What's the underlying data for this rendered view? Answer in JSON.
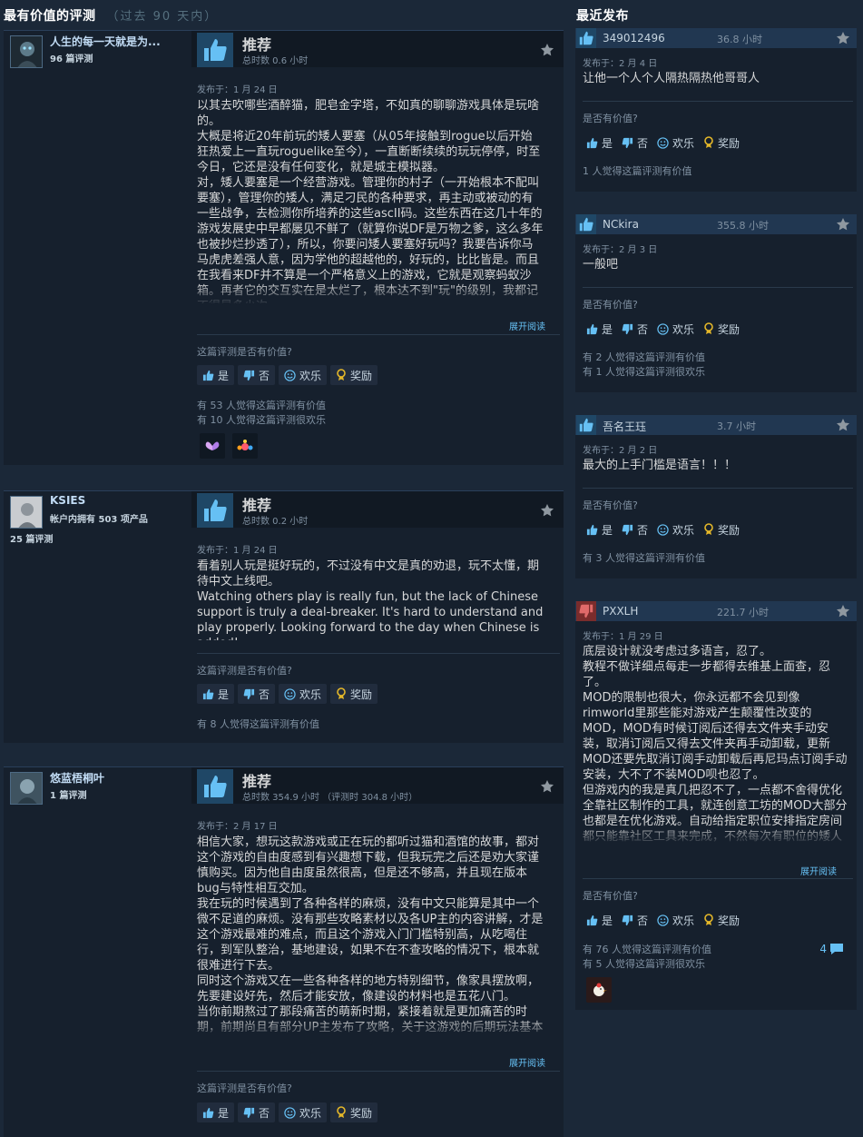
{
  "left_section": {
    "title": "最有价值的评测",
    "subtitle": "（过去 90 天内）"
  },
  "right_section": {
    "title": "最近发布"
  },
  "labels": {
    "recommended": "推荐",
    "helpful_question": "这篇评测是否有价值?",
    "yes": "是",
    "no": "否",
    "funny": "欢乐",
    "award": "奖励",
    "read_more": "展开阅读",
    "helpful_question_short": "是否有价值?"
  },
  "colors": {
    "background": "#1b2838",
    "card": "#16202d",
    "accent_link": "#66c0f4",
    "thumb_up_bg": "#1f4766",
    "thumb_down_bg": "#7a2c2c"
  },
  "reviews": [
    {
      "author": "人生的每一天就是为...",
      "author_line2": "96 篇评测",
      "author_line3": "",
      "recommendation": "推荐",
      "hours": "总时数 0.6 小时",
      "posted": "发布于：1 月 24 日",
      "text": "以其去吹哪些酒醉猫，肥皂金字塔，不如真的聊聊游戏具体是玩啥的。\n大概是将近20年前玩的矮人要塞（从05年接触到rogue以后开始狂热爱上一直玩roguelike至今），一直断断续续的玩玩停停，时至今日，它还是没有任何变化，就是城主模拟器。\n对，矮人要塞是一个经营游戏。管理你的村子（一开始根本不配叫要塞），管理你的矮人，满足刁民的各种要求，再主动或被动的有一些战争，去检测你所培养的这些ascII码。这些东西在这几十年的游戏发展史中早都屡见不鲜了（就算你说DF是万物之爹，这么多年也被抄烂抄透了），所以，你要问矮人要塞好玩吗？我要告诉你马马虎虎差强人意，因为学他的超越他的，好玩的，比比皆是。而且在我看来DF并不算是一个严格意义上的游戏，它就是观察蚂蚁沙箱。再者它的交互实在是太烂了，根本达不到\"玩\"的级别，我都记不得是多少次",
      "read_more": "展开阅读",
      "votes": "有 53 人觉得这篇评测有价值\n有 10 人觉得这篇评测很欢乐"
    },
    {
      "author": "KSIES",
      "author_line2": "帐户内拥有 503 项产品",
      "author_line3": "25 篇评测",
      "recommendation": "推荐",
      "hours": "总时数 0.2 小时",
      "posted": "发布于：1 月 24 日",
      "text": "看着别人玩是挺好玩的，不过没有中文是真的劝退，玩不太懂，期待中文上线吧。\nWatching others play is really fun, but the lack of Chinese support is truly a deal-breaker. It's hard to understand and play properly. Looking forward to the day when Chinese is added!",
      "votes": "有 8 人觉得这篇评测有价值"
    },
    {
      "author": "悠蓝梧桐叶",
      "author_line2": "1 篇评测",
      "author_line3": "",
      "recommendation": "推荐",
      "hours": "总时数 354.9 小时 （评测时 304.8 小时）",
      "posted": "发布于：2 月 17 日",
      "text": "相信大家，想玩这款游戏或正在玩的都听过猫和酒馆的故事，都对这个游戏的自由度感到有兴趣想下载，但我玩完之后还是劝大家谨慎购买。因为他自由度虽然很高，但是还不够高，并且现在版本bug与特性相互交加。\n我在玩的时候遇到了各种各样的麻烦，没有中文只能算是其中一个微不足道的麻烦。没有那些攻略素材以及各UP主的内容讲解，才是这个游戏最难的难点，而且这个游戏入门门槛特别高，从吃喝住行，到军队整治，基地建设，如果不在不查攻略的情况下，根本就很难进行下去。\n同时这个游戏又在一些各种各样的地方特别细节，像家具摆放啊，先要建设好先，然后才能安放，像建设的材料也是五花八门。\n当你前期熬过了那段痛苦的萌新时期，紧接着就是更加痛苦的时期，前期尚且有部分UP主发布了攻略，关于这游戏的后期玩法基本没",
      "read_more": "展开阅读"
    }
  ],
  "recent": [
    {
      "type": "up",
      "author": "349012496",
      "hours": "36.8 小时",
      "posted": "发布于：2 月 4 日",
      "text": "让他一个人个人隔热隔热他哥哥人",
      "votes": "1 人觉得这篇评测有价值"
    },
    {
      "type": "up",
      "author": "NCkira",
      "hours": "355.8 小时",
      "posted": "发布于：2 月 3 日",
      "text": "一般吧",
      "votes": "有 2 人觉得这篇评测有价值\n有 1 人觉得这篇评测很欢乐"
    },
    {
      "type": "up",
      "author": "吾名王珏",
      "hours": "3.7 小时",
      "posted": "发布于：2 月 2 日",
      "text": "最大的上手门槛是语言！！！",
      "votes": "有 3 人觉得这篇评测有价值"
    },
    {
      "type": "down",
      "author": "PXXLH",
      "hours": "221.7 小时",
      "posted": "发布于：1 月 29 日",
      "text": "底层设计就没考虑过多语言，忍了。\n教程不做详细点每走一步都得去维基上面查，忍了。\nMOD的限制也很大，你永远都不会见到像rimworld里那些能对游戏产生颠覆性改变的MOD，MOD有时候订阅后还得去文件夹手动安装，取消订阅后又得去文件夹再手动卸载，更新MOD还要先取消订阅手动卸载后再尼玛点订阅手动安装，大不了不装MOD呗也忍了。\n但游戏内的我是真几把忍不了，一点都不舍得优化全靠社区制作的工具，就连创意工坊的MOD大部分也都是在优化游戏。自动给指定职位安排指定房间都只能靠社区工具来完成，不然每次有职位的矮人",
      "read_more": "展开阅读",
      "votes": "有 76 人觉得这篇评测有价值\n有 5 人觉得这篇评测很欢乐",
      "comments": "4"
    }
  ]
}
